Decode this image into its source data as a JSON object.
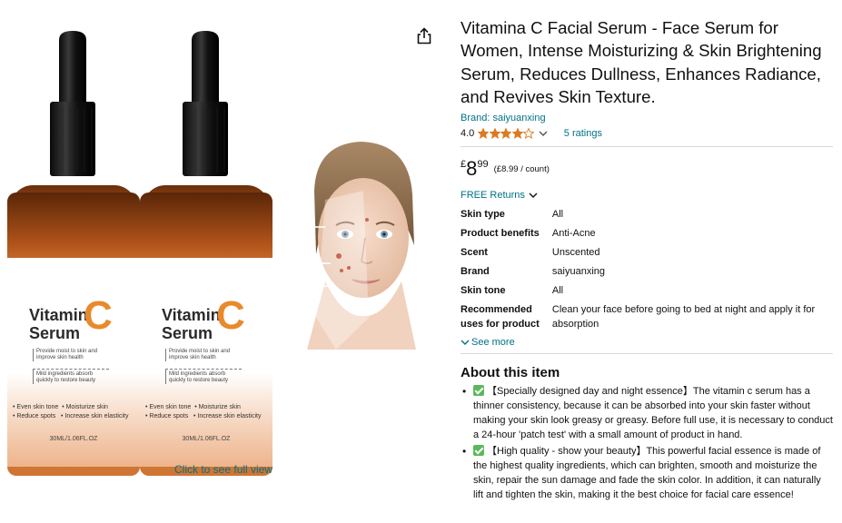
{
  "product": {
    "title": "Vitamina C Facial Serum - Face Serum for Women, Intense Moisturizing & Skin Brightening Serum, Reduces Dullness, Enhances Radiance, and Revives Skin Texture.",
    "brand_link": "Brand: saiyuanxing",
    "rating_value": "4.0",
    "stars_filled": 4,
    "stars_total": 5,
    "ratings_count": "5 ratings",
    "price_symbol": "£",
    "price_whole": "8",
    "price_fraction": "99",
    "price_per_unit": "(£8.99 / count)",
    "returns_label": "FREE Returns",
    "see_more": "See more",
    "colors": {
      "link": "#007185",
      "star": "#de7921",
      "check": "#5cb85c"
    }
  },
  "specs": [
    {
      "key": "Skin type",
      "value": "All"
    },
    {
      "key": "Product benefits",
      "value": "Anti-Acne"
    },
    {
      "key": "Scent",
      "value": "Unscented"
    },
    {
      "key": "Brand",
      "value": "saiyuanxing"
    },
    {
      "key": "Skin tone",
      "value": "All"
    },
    {
      "key": "Recommended uses for product",
      "value": "Clean your face before going to bed at night and apply it for absorption"
    }
  ],
  "about": {
    "heading": "About this item",
    "bullets": [
      "【Specially designed day and night essence】The vitamin c serum has a thinner consistency, because it can be absorbed into your skin faster without making your skin look greasy or greasy. Before full use, it is necessary to conduct a 24-hour 'patch test' with a small amount of product in hand.",
      "【High quality - show your beauty】This powerful facial essence is made of the highest quality ingredients, which can brighten, smooth and moisturize the skin, repair the sun damage and fade the skin color. In addition, it can naturally lift and tighten the skin, making it the best choice for facial care essence!"
    ]
  },
  "gallery": {
    "see_full_view": "Click to see full view",
    "bottle_label": {
      "title_line1": "Vitamin",
      "title_line2": "Serum",
      "big_letter": "C",
      "desc1": "Provide moist to skin and improve skin health",
      "desc2": "Mild ingredients absorb quickly to restore beauty",
      "features": "• Even skin tone  • Moisturize skin\n• Reduce spots   • Increase skin elasticity",
      "volume": "30ML/1.06FL.OZ"
    }
  }
}
